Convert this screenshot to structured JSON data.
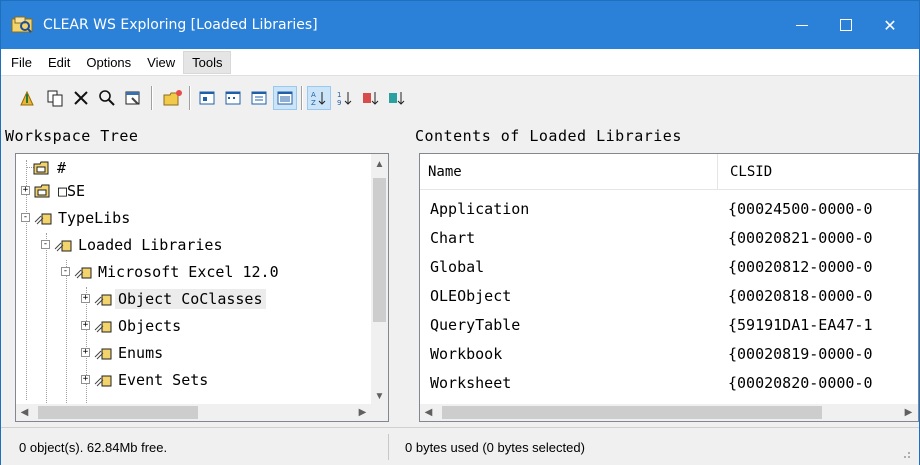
{
  "window": {
    "title": "CLEAR WS Exploring [Loaded Libraries]",
    "controls": {
      "minimize": "minimize",
      "maximize": "maximize",
      "close": "✕"
    }
  },
  "menu": [
    {
      "label": "File"
    },
    {
      "label": "Edit"
    },
    {
      "label": "Options"
    },
    {
      "label": "View"
    },
    {
      "label": "Tools"
    }
  ],
  "toolbar": {
    "buttons": [
      {
        "icon": "go-up-icon"
      },
      {
        "icon": "copy-icon"
      },
      {
        "icon": "delete-icon"
      },
      {
        "icon": "search-icon"
      },
      {
        "icon": "properties-icon"
      },
      {
        "icon": "new-folder-icon"
      },
      {
        "icon": "large-icons-view-icon"
      },
      {
        "icon": "small-icons-view-icon"
      },
      {
        "icon": "list-view-icon"
      },
      {
        "icon": "details-view-icon"
      },
      {
        "icon": "sort-az-icon"
      },
      {
        "icon": "sort-numeric-icon"
      },
      {
        "icon": "sort-type-icon"
      },
      {
        "icon": "sort-size-icon"
      }
    ]
  },
  "left_pane": {
    "header": "Workspace Tree",
    "tree": [
      {
        "label": "#",
        "level": 0,
        "expander": ""
      },
      {
        "label": "□SE",
        "level": 0,
        "expander": "+"
      },
      {
        "label": "TypeLibs",
        "level": 0,
        "expander": "-"
      },
      {
        "label": "Loaded Libraries",
        "level": 1,
        "expander": "-"
      },
      {
        "label": "Microsoft Excel 12.0",
        "level": 2,
        "expander": "-"
      },
      {
        "label": "Object CoClasses",
        "level": 3,
        "expander": "+",
        "selected": true
      },
      {
        "label": "Objects",
        "level": 3,
        "expander": "+"
      },
      {
        "label": "Enums",
        "level": 3,
        "expander": "+"
      },
      {
        "label": "Event Sets",
        "level": 3,
        "expander": "+"
      }
    ]
  },
  "right_pane": {
    "header": "Contents of Loaded Libraries",
    "columns": {
      "name": "Name",
      "clsid": "CLSID"
    },
    "rows": [
      {
        "name": "Application",
        "clsid": "{00024500-0000-0"
      },
      {
        "name": "Chart",
        "clsid": "{00020821-0000-0"
      },
      {
        "name": "Global",
        "clsid": "{00020812-0000-0"
      },
      {
        "name": "OLEObject",
        "clsid": "{00020818-0000-0"
      },
      {
        "name": "QueryTable",
        "clsid": "{59191DA1-EA47-1"
      },
      {
        "name": "Workbook",
        "clsid": "{00020819-0000-0"
      },
      {
        "name": "Worksheet",
        "clsid": "{00020820-0000-0"
      }
    ]
  },
  "status": {
    "left": "0 object(s). 62.84Mb free.",
    "right": "0 bytes used (0 bytes selected)"
  },
  "colors": {
    "titlebar": "#2b80d8",
    "pressed_button": "#cce4f7",
    "selection": "#ececec"
  }
}
